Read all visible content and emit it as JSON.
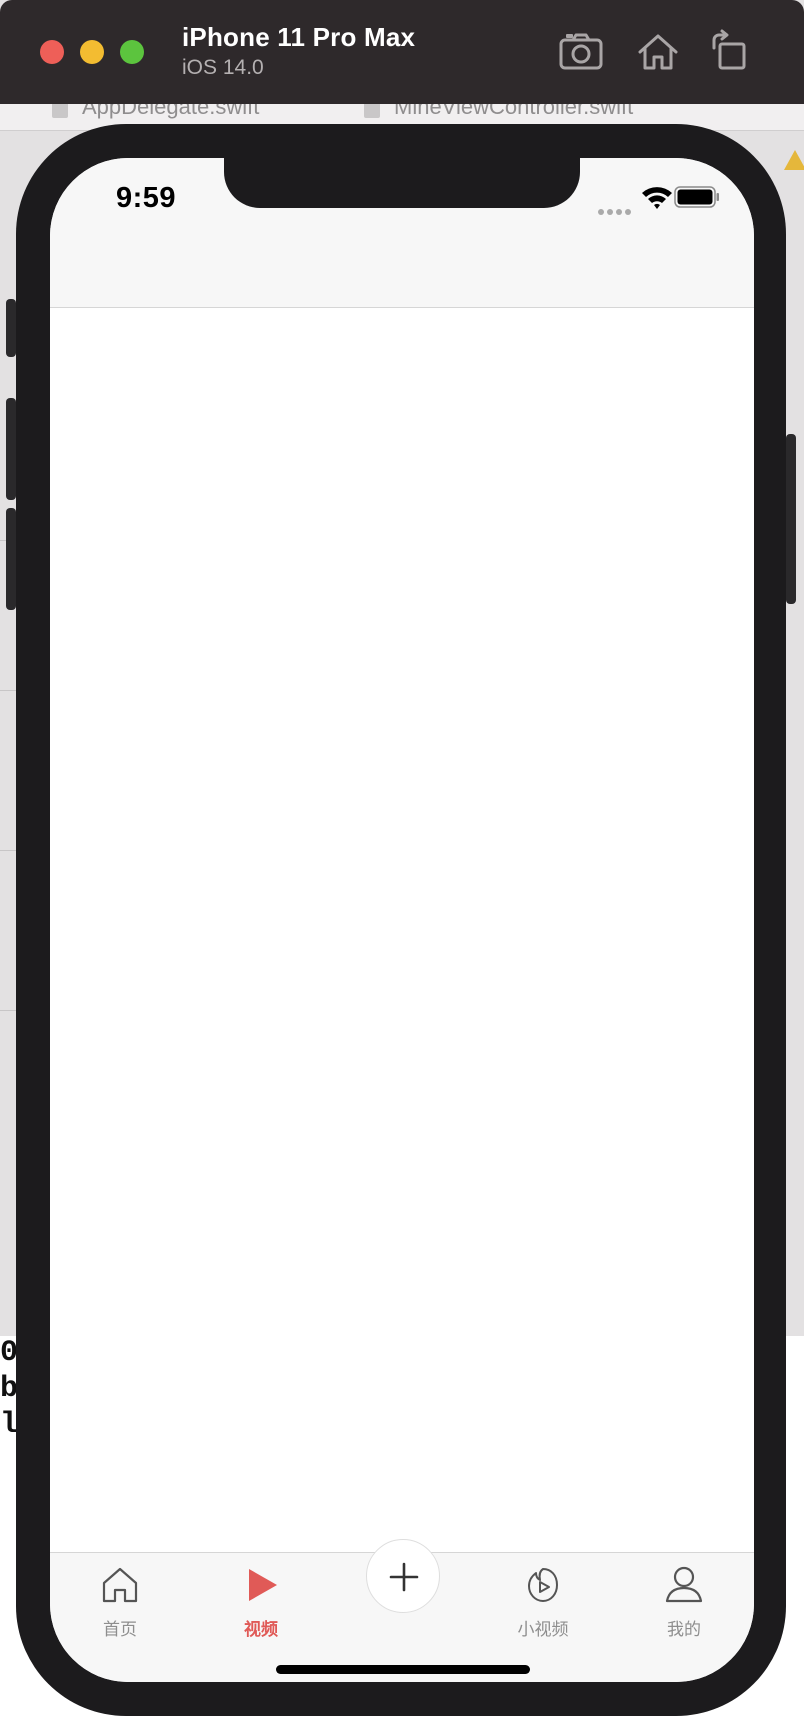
{
  "simulator": {
    "device_name": "iPhone 11 Pro Max",
    "os_version": "iOS 14.0",
    "toolbar": {
      "screenshot_icon": "camera-icon",
      "home_icon": "home-icon",
      "rotate_icon": "rotate-icon"
    }
  },
  "xcode_background": {
    "tabs": [
      "AppDelegate.swift",
      "MineViewController.swift"
    ],
    "console_lines": [
      "0",
      "b",
      "l"
    ]
  },
  "status_bar": {
    "time": "9:59",
    "icons": [
      "signal-dots-icon",
      "wifi-icon",
      "battery-icon"
    ]
  },
  "tab_bar": {
    "items": [
      {
        "label": "首页",
        "icon": "home-outline-icon",
        "active": false
      },
      {
        "label": "视频",
        "icon": "play-icon",
        "active": true
      },
      {
        "label": "",
        "icon": "plus-icon",
        "active": false
      },
      {
        "label": "小视频",
        "icon": "short-video-icon",
        "active": false
      },
      {
        "label": "我的",
        "icon": "user-icon",
        "active": false
      }
    ],
    "active_color": "#e05a57",
    "inactive_color": "#8e8e8e"
  }
}
